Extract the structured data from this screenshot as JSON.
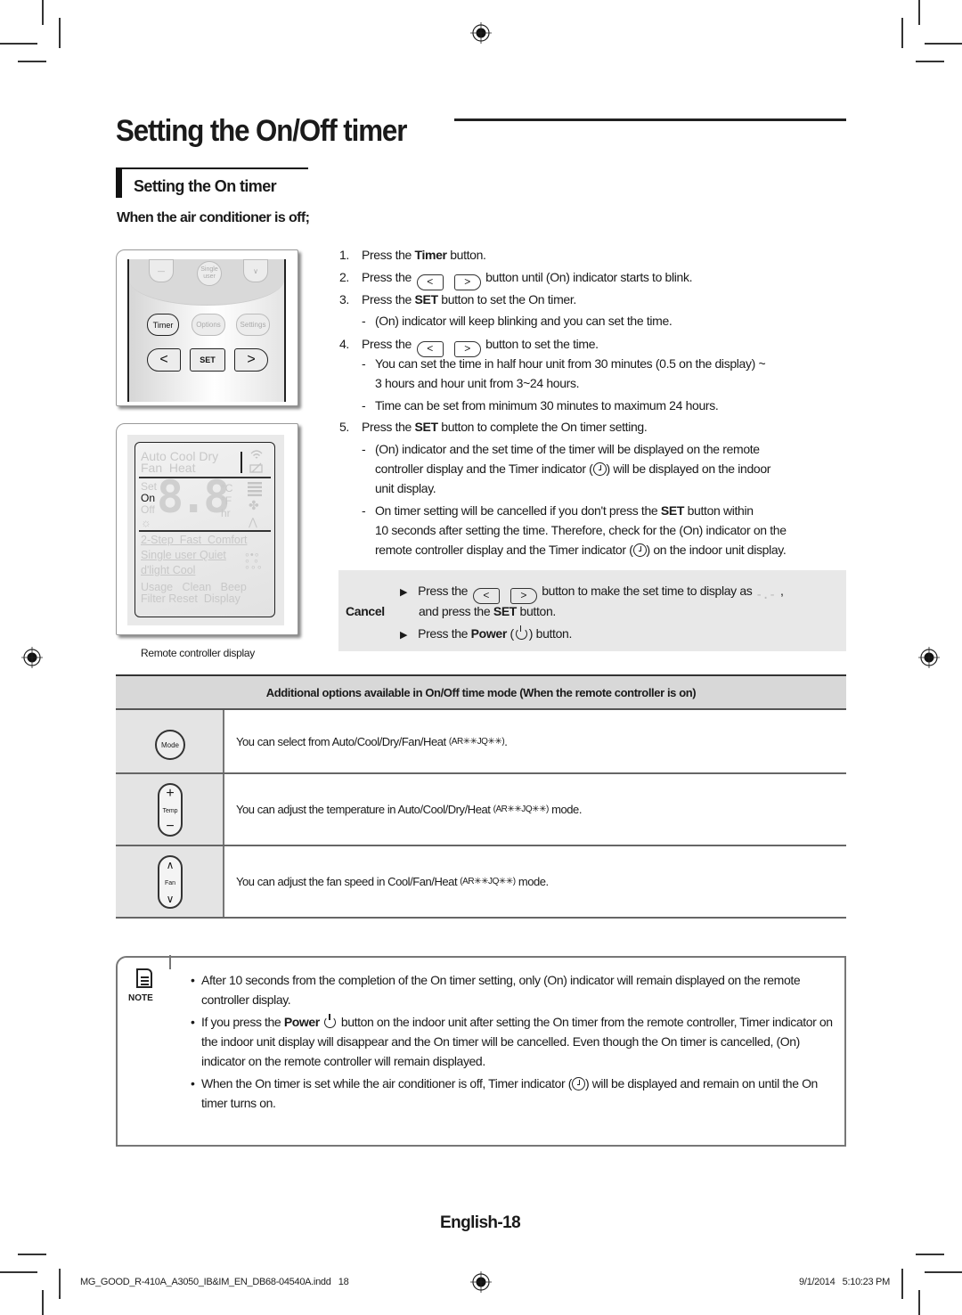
{
  "page": {
    "title": "Setting the On/Off timer",
    "section_title": "Setting the On timer",
    "condition": "When the air conditioner is off;",
    "page_number": "English-18"
  },
  "remote_keys": {
    "top_row": [
      "—",
      "Single user",
      "∨"
    ],
    "timer": "Timer",
    "options": "Options",
    "settings": "Settings",
    "left": "<",
    "set": "SET",
    "right": ">"
  },
  "remote_display": {
    "modes_line1": "Auto Cool Dry",
    "modes_line2": "Fan  Heat",
    "set": "Set",
    "on": "On",
    "off": "Off",
    "digits": "8.8",
    "unit_c": "°C",
    "unit_f": "°F",
    "unit_hr": "hr",
    "row1": "2-Step  Fast  Comfort",
    "row2": "Single user Quiet",
    "row3": "d'light Cool",
    "row4": "Usage   Clean   Beep",
    "row5": "Filter Reset  Display",
    "caption": "Remote controller display"
  },
  "steps": [
    {
      "num": "1.",
      "pre": "Press the ",
      "bold": "Timer",
      "post": " button."
    },
    {
      "num": "2.",
      "pre": "Press the",
      "post": "button until (On) indicator starts to blink."
    },
    {
      "num": "3.",
      "pre": "Press the ",
      "bold": "SET",
      "post": " button to set the On timer."
    },
    {
      "num": "4.",
      "pre": "Press the",
      "post": "button to set the time."
    },
    {
      "num": "5.",
      "pre": "Press the ",
      "bold": "SET",
      "post": " button to complete the On timer setting."
    }
  ],
  "step3_sub": [
    "(On) indicator will keep blinking and you can set the time."
  ],
  "step4_sub": [
    "You can set the time in half hour unit from 30 minutes (0.5 on the display) ~",
    "3 hours and hour unit from 3~24 hours.",
    "Time can be set from minimum 30 minutes to maximum 24 hours."
  ],
  "step5_sub": {
    "a1": "(On) indicator and the set time of the timer will be displayed on the remote",
    "a2_pre": "controller display and the Timer indicator (",
    "a2_post": ") will be displayed on the indoor",
    "a3": "unit display.",
    "b1_pre": "On timer setting will be cancelled if you don't press the ",
    "b1_bold": "SET",
    "b1_post": " button within",
    "b2": "10 seconds after setting the time. Therefore, check for the (On) indicator on the",
    "b3_pre": "remote controller display and the Timer indicator (",
    "b3_post": ") on the indoor unit display."
  },
  "cancel": {
    "label": "Cancel",
    "line1_pre": "Press the",
    "line1_post": "button to make the set time to display as",
    "line1_end": ",",
    "dash_display": "-.-",
    "line2_pre": "and press the ",
    "line2_bold": "SET",
    "line2_post": " button.",
    "line3_pre": "Press the ",
    "line3_bold": "Power",
    "line3_mid": " (",
    "line3_post": ") button."
  },
  "options_table": {
    "header": "Additional options available in On/Off time mode (When the remote controller is on)",
    "rows": [
      {
        "icon": "Mode",
        "text": "You can select from Auto/Cool/Dry/Fan/Heat ",
        "model": "(AR✳✳JQ✳✳)",
        "tail": "."
      },
      {
        "icon": "Temp",
        "text": "You can adjust the temperature in Auto/Cool/Dry/Heat ",
        "model": "(AR✳✳JQ✳✳)",
        "tail": " mode."
      },
      {
        "icon": "Fan",
        "text": "You can adjust the fan speed in Cool/Fan/Heat ",
        "model": "(AR✳✳JQ✳✳)",
        "tail": " mode."
      }
    ]
  },
  "note": {
    "label": "NOTE",
    "items": [
      {
        "a": "After 10 seconds from the completion of the On timer setting, only (On) indicator will remain displayed on the remote controller display."
      },
      {
        "pre": "If you press the ",
        "bold": "Power",
        "post": " button on the indoor unit after setting the On timer from the remote controller, Timer indicator on the indoor unit display will disappear and the On timer will be cancelled. Even though the On timer is cancelled, (On) indicator on the remote controller will remain displayed."
      },
      {
        "pre": "When the On timer is set while the air conditioner is off, Timer indicator (",
        "post": ") will be displayed and remain on until the On timer turns on."
      }
    ]
  },
  "footer": {
    "file": "MG_GOOD_R-410A_A3050_IB&IM_EN_DB68-04540A.indd   18",
    "datetime": "9/1/2014   5:10:23 PM"
  }
}
